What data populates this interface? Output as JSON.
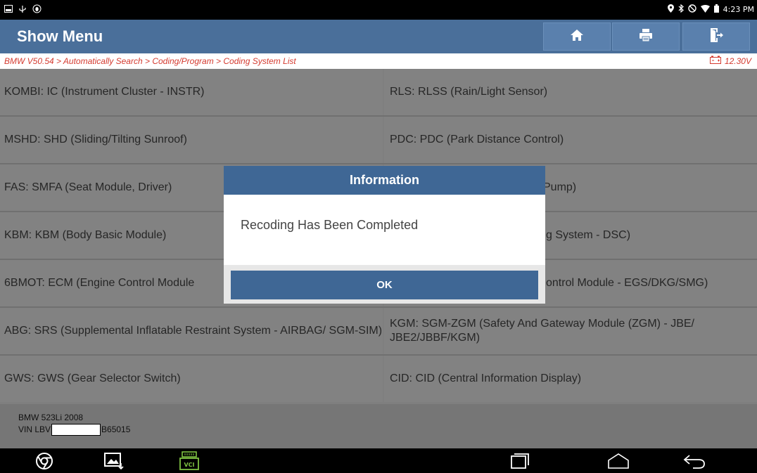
{
  "status_bar": {
    "time": "4:23 PM"
  },
  "header": {
    "title": "Show Menu"
  },
  "breadcrumb": {
    "path": "BMW V50.54 > Automatically Search > Coding/Program > Coding System List",
    "battery": "12.30V"
  },
  "systems": {
    "left": [
      "KOMBI: IC (Instrument Cluster - INSTR)",
      "MSHD: SHD (Sliding/Tilting Sunroof)",
      "FAS: SMFA (Seat Module, Driver)",
      "KBM: KBM (Body Basic Module)",
      "6BMOT: ECM (Engine Control Module",
      "ABG: SRS (Supplemental Inflatable Restraint System - AIRBAG/ SGM-SIM)",
      "GWS: GWS (Gear Selector Switch)"
    ],
    "right": [
      "RLS: RLSS (Rain/Light Sensor)",
      "PDC: PDC (Park Distance Control)",
      " Pump)",
      "g System - DSC)",
      "ontrol Module - EGS/DKG/SMG)",
      "KGM: SGM-ZGM (Safety And Gateway Module (ZGM) - JBE/ JBE2/JBBF/KGM)",
      "CID: CID (Central Information Display)"
    ]
  },
  "vehicle": {
    "model": "BMW 523Li 2008",
    "vin_prefix": "VIN LBV",
    "vin_suffix": "B65015"
  },
  "dialog": {
    "title": "Information",
    "message": "Recoding Has Been Completed",
    "ok_label": "OK"
  },
  "icons": {
    "nav": [
      "chrome-icon",
      "screenshot-icon",
      "vci-icon",
      "recent-apps-icon",
      "home-icon",
      "back-icon"
    ],
    "vci_label": "VCI"
  },
  "colors": {
    "header": "#4a6f9a",
    "dialog_accent": "#3f6795",
    "breadcrumb_text": "#d43a2f",
    "vci_green": "#7ec242"
  }
}
